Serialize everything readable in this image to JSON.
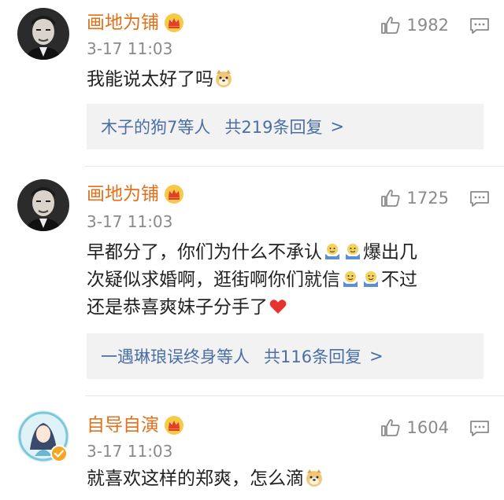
{
  "comments": [
    {
      "username": "画地为铺",
      "time": "3-17 11:03",
      "likes": "1982",
      "text": "我能说太好了吗",
      "replies_users": "木子的狗7等人",
      "replies_count": "共219条回复",
      "avatar_icon": "man-portrait-avatar",
      "badge_icon": "crown-badge-icon"
    },
    {
      "username": "画地为铺",
      "time": "3-17 11:03",
      "likes": "1725",
      "text_line1": "早都分了，你们为什么不承认",
      "text_line1_tail": "爆出几",
      "text_line2": "次疑似求婚啊，逛街啊你们就信",
      "text_line2_tail": "不过",
      "text_line3": "还是恭喜爽妹子分手了",
      "replies_users": "一遇琳琅误终身等人",
      "replies_count": "共116条回复",
      "avatar_icon": "man-portrait-avatar",
      "badge_icon": "crown-badge-icon"
    },
    {
      "username": "自导自演",
      "time": "3-17 11:03",
      "likes": "1604",
      "text": "就喜欢这样的郑爽，怎么滴",
      "avatar_icon": "girl-illustration-avatar",
      "badge_icon": "crown-badge-icon"
    }
  ],
  "reply_arrow": ">",
  "colors": {
    "username": "#e2711c",
    "meta": "#8a8a8a",
    "reply_link": "#4a6fa5",
    "reply_bg": "#f2f2f2"
  }
}
